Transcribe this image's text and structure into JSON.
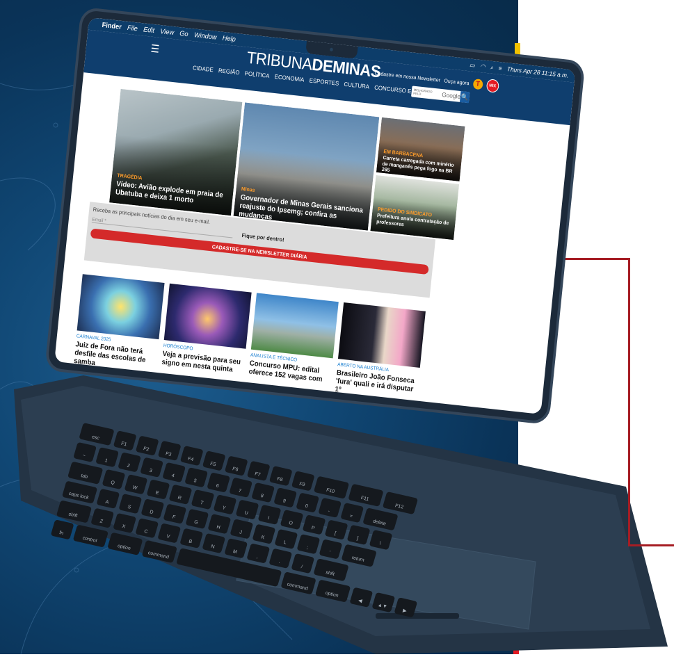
{
  "colors": {
    "brand": "#0f3e6e",
    "accent_red": "#d42a2a",
    "kicker": "#1a7fd0",
    "tag_orange": "#ff9d2b"
  },
  "menubar": {
    "apple": "",
    "app": "Finder",
    "items": [
      "File",
      "Edit",
      "View",
      "Go",
      "Window",
      "Help"
    ],
    "clock": "Thurs Apr 28 11:15 a.m."
  },
  "site": {
    "logo_part1": "TRIBUNA",
    "logo_part2": "DE",
    "logo_part3": "MINAS",
    "nav": [
      "CIDADE",
      "REGIÃO",
      "POLÍTICA",
      "ECONOMIA",
      "ESPORTES",
      "CULTURA",
      "CONCURSO E EMPREGOS"
    ],
    "newsletter_link": "Cadastre em nossa Newsletter",
    "listen": "Ouça agora",
    "badge_t": "T",
    "badge_mix": "MIX",
    "search_placeholder": "MELHORADO PELO",
    "search_brand": "Google",
    "search_icon": "🔍"
  },
  "featured": [
    {
      "tag": "TRAGÉDIA",
      "title": "Vídeo: Avião explode em praia de Ubatuba e deixa 1 morto"
    },
    {
      "tag": "Minas",
      "title": "Governador de Minas Gerais sanciona reajuste do Ipsemg; confira as mudanças"
    },
    {
      "tag": "EM BARBACENA",
      "title": "Carreta carregada com minério de manganês pega fogo na BR 265"
    },
    {
      "tag": "PEDIDO DO SINDICATO",
      "title": "Prefeitura anula contratação de professores"
    }
  ],
  "newsletter": {
    "lead": "Receba as principais notícias do dia em seu e-mail.",
    "email_label": "Email *",
    "fique": "Fique por dentro!",
    "cta": "CADASTRE-SE NA NEWSLETTER DIÁRIA"
  },
  "stories": [
    {
      "kicker": "CARNAVAL 2025",
      "headline": "Juiz de Fora não terá desfile das escolas de samba"
    },
    {
      "kicker": "HORÓSCOPO",
      "headline": "Veja a previsão para seu signo em nesta quinta"
    },
    {
      "kicker": "ANALISTA E TÉCNICO",
      "headline": "Concurso MPU: edital oferece 152 vagas com"
    },
    {
      "kicker": "ABERTO NA AUSTRÁLIA",
      "headline": "Brasileiro João Fonseca 'fura' quali e irá disputar 1º"
    }
  ],
  "keyboard": {
    "row1": [
      "esc",
      "F1",
      "F2",
      "F3",
      "F4",
      "F5",
      "F6",
      "F7",
      "F8",
      "F9",
      "F10",
      "F11",
      "F12"
    ],
    "row2": [
      "~",
      "1",
      "2",
      "3",
      "4",
      "5",
      "6",
      "7",
      "8",
      "9",
      "0",
      "-",
      "=",
      "delete"
    ],
    "row3": [
      "tab",
      "Q",
      "W",
      "E",
      "R",
      "T",
      "Y",
      "U",
      "I",
      "O",
      "P",
      "[",
      "]",
      "\\"
    ],
    "row4": [
      "caps lock",
      "A",
      "S",
      "D",
      "F",
      "G",
      "H",
      "J",
      "K",
      "L",
      ";",
      "'",
      "return"
    ],
    "row5": [
      "shift",
      "Z",
      "X",
      "C",
      "V",
      "B",
      "N",
      "M",
      ",",
      ".",
      "/",
      "shift"
    ],
    "row6": [
      "fn",
      "control",
      "option",
      "command",
      "",
      "command",
      "option",
      "◀",
      "▲▼",
      "▶"
    ]
  }
}
